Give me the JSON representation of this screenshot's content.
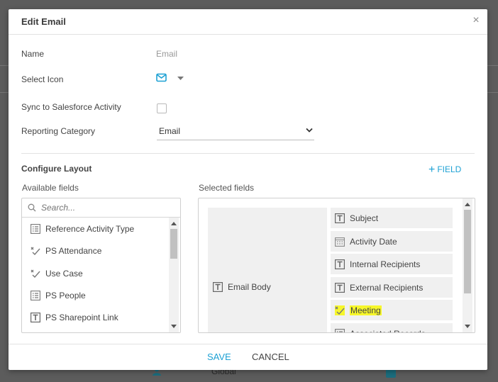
{
  "modal": {
    "title": "Edit Email",
    "close_glyph": "×"
  },
  "form": {
    "name_label": "Name",
    "name_value": "Email",
    "icon_label": "Select Icon",
    "icon_name": "envelope-icon",
    "sync_label": "Sync to Salesforce Activity",
    "sync_checked": false,
    "category_label": "Reporting Category",
    "category_value": "Email"
  },
  "layout": {
    "section_title": "Configure Layout",
    "add_field_label": "FIELD",
    "available_label": "Available fields",
    "selected_label": "Selected fields",
    "search_placeholder": "Search...",
    "available_fields": [
      {
        "label": "Reference Activity Type",
        "icon": "list-icon"
      },
      {
        "label": "PS Attendance",
        "icon": "multi-check-icon"
      },
      {
        "label": "Use Case",
        "icon": "multi-check-icon"
      },
      {
        "label": "PS People",
        "icon": "list-icon"
      },
      {
        "label": "PS Sharepoint Link",
        "icon": "text-icon"
      }
    ],
    "body_field": {
      "label": "Email Body",
      "icon": "text-icon"
    },
    "selected_fields": [
      {
        "label": "Subject",
        "icon": "text-icon"
      },
      {
        "label": "Activity Date",
        "icon": "calendar-icon"
      },
      {
        "label": "Internal Recipients",
        "icon": "text-icon"
      },
      {
        "label": "External Recipients",
        "icon": "text-icon"
      },
      {
        "label": "Meeting",
        "icon": "multi-check-icon",
        "highlighted": true
      },
      {
        "label": "Associated Records",
        "icon": "list-icon"
      }
    ]
  },
  "footer": {
    "save_label": "SAVE",
    "cancel_label": "CANCEL"
  },
  "background": {
    "footer_text": "Global"
  },
  "colors": {
    "accent": "#1da1d4",
    "highlight": "#f7f72a",
    "field_bg": "#f0f0f0"
  }
}
